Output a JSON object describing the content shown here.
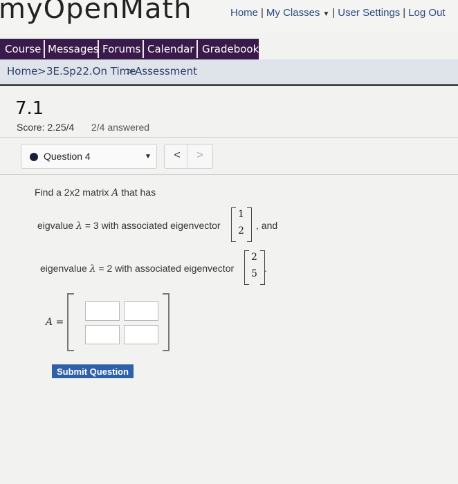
{
  "header": {
    "logo_text": "myOpenMath",
    "links": [
      "Home",
      "My Classes",
      "User Settings",
      "Log Out"
    ]
  },
  "nav": {
    "tabs": [
      "Course",
      "Messages",
      "Forums",
      "Calendar",
      "Gradebook"
    ]
  },
  "breadcrumb": [
    "Home",
    "3E.Sp22.On Time",
    "Assessment"
  ],
  "breadcrumb_sep": ">",
  "assessment": {
    "title": "7.1",
    "score": "Score: 2.25/4",
    "answered": "2/4 answered"
  },
  "question_nav": {
    "selected": "Question 4",
    "prev": "<",
    "next": ">"
  },
  "question": {
    "prompt_prefix": "Find a 2x2 matrix",
    "matrix_var": "A",
    "prompt_suffix": "that has",
    "line1_label": "eigvalue",
    "line1_lambda": "λ",
    "line1_eq": "=",
    "line1_value": "3",
    "line1_text": "with associated eigenvector",
    "vec1_top": "1",
    "vec1_bottom": "2",
    "line1_tail": ", and",
    "line2_label": "eigenvalue",
    "line2_lambda": "λ",
    "line2_eq": "=",
    "line2_value": "2",
    "line2_text": "with associated eigenvector",
    "vec2_top": "2",
    "vec2_bottom": "5",
    "line2_tail": ".",
    "answer_label": "A ="
  },
  "submit_label": "Submit Question",
  "colors": {
    "nav_bg": "#3a1a4a",
    "breadcrumb_bg": "#dfe3ea",
    "link": "#2b4b7e",
    "submit_bg": "#2f61a8"
  }
}
